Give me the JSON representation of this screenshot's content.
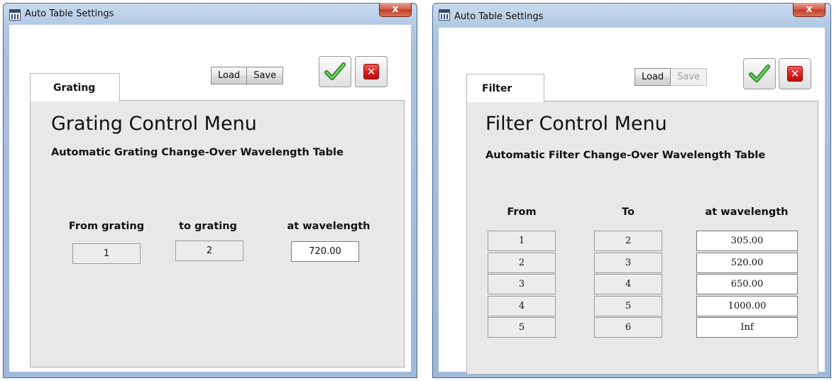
{
  "left_window": {
    "title": "Auto Table Settings",
    "close_glyph": "x",
    "tab_label": "Grating",
    "buttons": {
      "load": "Load",
      "save": "Save"
    },
    "heading": "Grating Control Menu",
    "subheading": "Automatic Grating Change-Over Wavelength Table",
    "columns": {
      "from": "From grating",
      "to": "to grating",
      "at": "at wavelength"
    },
    "row": {
      "from": "1",
      "to": "2",
      "at": "720.00"
    }
  },
  "right_window": {
    "title": "Auto Table Settings",
    "close_glyph": "x",
    "tab_label": "Filter",
    "buttons": {
      "load": "Load",
      "save": "Save"
    },
    "heading": "Filter Control Menu",
    "subheading": "Automatic Filter Change-Over  Wavelength Table",
    "columns": {
      "from": "From",
      "to": "To",
      "at": "at wavelength"
    },
    "rows": [
      {
        "from": "1",
        "to": "2",
        "at": "305.00"
      },
      {
        "from": "2",
        "to": "3",
        "at": "520.00"
      },
      {
        "from": "3",
        "to": "4",
        "at": "650.00"
      },
      {
        "from": "4",
        "to": "5",
        "at": "1000.00"
      },
      {
        "from": "5",
        "to": "6",
        "at": "Inf"
      }
    ]
  },
  "icons": {
    "ok": "check-icon",
    "cancel": "cancel-x-icon"
  },
  "colors": {
    "ok_green": "#3aa532",
    "cancel_red": "#d91d1d",
    "panel": "#e8e8e8"
  }
}
